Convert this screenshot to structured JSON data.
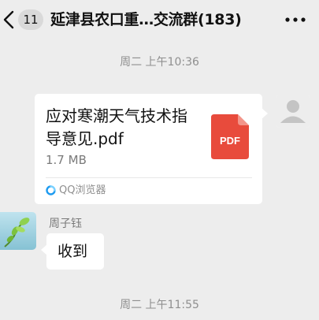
{
  "header": {
    "unread_count": "11",
    "title": "延津县农口重…交流群(183)"
  },
  "messages": {
    "timestamp_1": "周二 上午10:36",
    "file": {
      "name": "应对寒潮天气技术指导意见.pdf",
      "size": "1.7 MB",
      "type_badge": "PDF",
      "open_with": "QQ浏览器"
    },
    "text_message": {
      "sender": "周子钰",
      "text": "收到"
    },
    "timestamp_2": "周二 上午11:55"
  },
  "colors": {
    "background": "#ededed",
    "bubble": "#ffffff",
    "pdf_red": "#e84b3c",
    "timestamp_gray": "#8f8f8f"
  },
  "icons": [
    "back-arrow-icon",
    "more-dots-icon",
    "pdf-file-icon",
    "qq-browser-icon",
    "default-avatar-icon",
    "plant-avatar-icon"
  ]
}
